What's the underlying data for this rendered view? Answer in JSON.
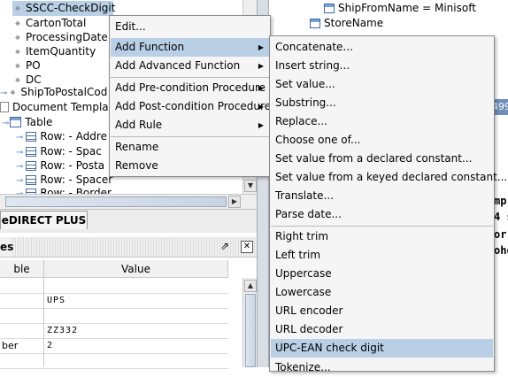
{
  "tree": {
    "items": [
      {
        "label": "SSCC-CheckDigit",
        "selected": true
      },
      {
        "label": "CartonTotal"
      },
      {
        "label": "ProcessingDate"
      },
      {
        "label": "ItemQuantity"
      },
      {
        "label": "PO"
      },
      {
        "label": "DC"
      },
      {
        "label": "ShipToPostalCod"
      },
      {
        "label": "Document Templat"
      },
      {
        "label": "Table"
      },
      {
        "label": "Row: - Addre"
      },
      {
        "label": "Row: - Spac"
      },
      {
        "label": "Row: - Posta"
      },
      {
        "label": "Row: - Spacer"
      },
      {
        "label": "Row: - Border"
      }
    ]
  },
  "tabs": {
    "active": "eDIRECT PLUS"
  },
  "properties": {
    "title": "es",
    "columns": [
      "ble",
      "Value"
    ],
    "rows": [
      {
        "name": "",
        "value": ""
      },
      {
        "name": "",
        "value": "UPS"
      },
      {
        "name": "",
        "value": ""
      },
      {
        "name": "",
        "value": "ZZ332"
      },
      {
        "name": "ber",
        "value": "2"
      },
      {
        "name": "",
        "value": ""
      }
    ]
  },
  "right_tree": {
    "items": [
      {
        "label": "ShipFromName = Minisoft"
      },
      {
        "label": "StoreName"
      }
    ],
    "doc_fragments": [
      "mp",
      "4 s",
      "or",
      "oho"
    ],
    "side_value": "499"
  },
  "context_menu": {
    "items": [
      {
        "label": "Edit...",
        "submenu": false
      },
      {
        "label": "Add Function",
        "submenu": true,
        "highlighted": true
      },
      {
        "label": "Add Advanced Function",
        "submenu": true
      },
      {
        "label": "Add Pre-condition Procedure",
        "submenu": true
      },
      {
        "label": "Add Post-condition Procedure",
        "submenu": true
      },
      {
        "label": "Add Rule",
        "submenu": true
      },
      {
        "label": "Rename",
        "submenu": false
      },
      {
        "label": "Remove",
        "submenu": false
      }
    ]
  },
  "function_menu": {
    "items": [
      "Concatenate...",
      "Insert string...",
      "Set value...",
      "Substring...",
      "Replace...",
      "Choose one of...",
      "Set value from a declared constant...",
      "Set value from a keyed declared constant...",
      "Translate...",
      "Parse date...",
      "Right trim",
      "Left trim",
      "Uppercase",
      "Lowercase",
      "URL encoder",
      "URL decoder",
      "UPC-EAN check digit",
      "Tokenize..."
    ],
    "highlighted": "UPC-EAN check digit"
  },
  "colors": {
    "highlight": "#b8cfe5",
    "menu_bg": "#f5f5f5"
  }
}
